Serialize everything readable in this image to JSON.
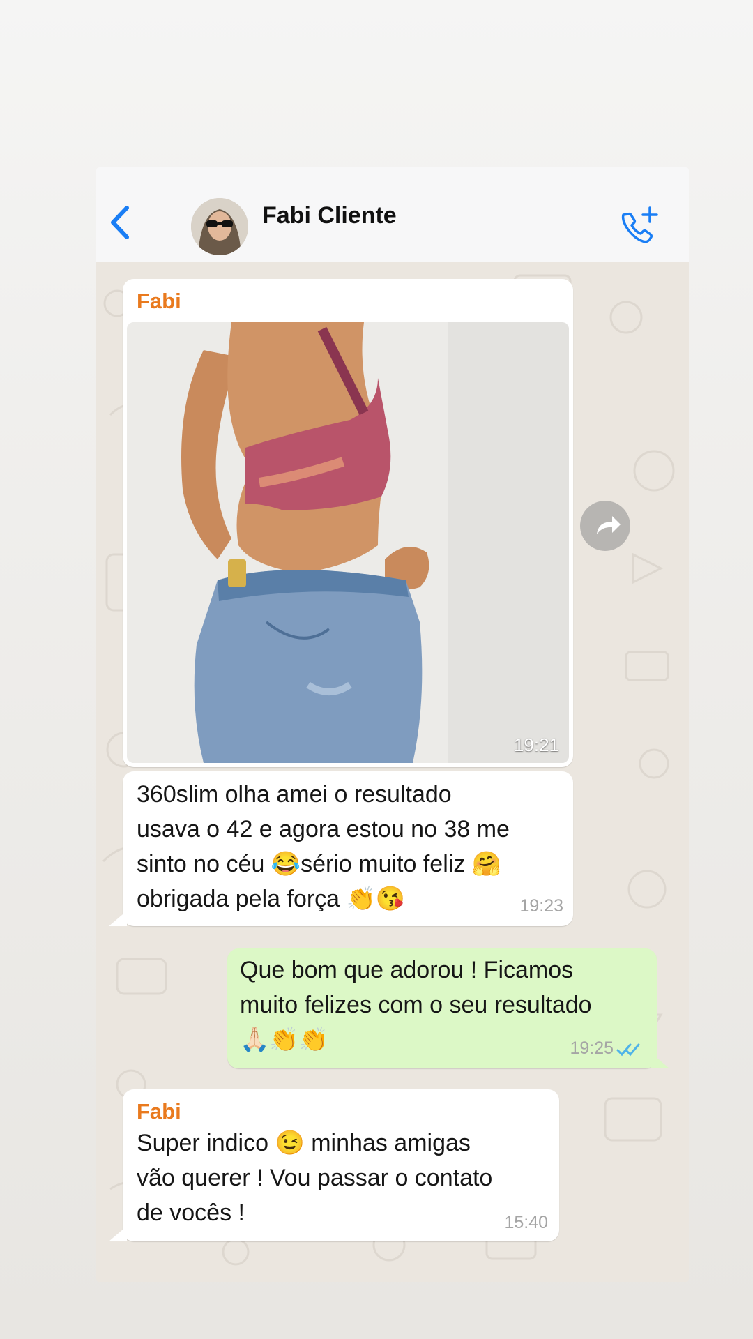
{
  "header": {
    "contact_name": "Fabi Cliente",
    "back_icon": "chevron-left-icon",
    "call_icon": "phone-add-icon",
    "accent_color": "#1a7ef5"
  },
  "messages": [
    {
      "direction": "incoming",
      "sender": "Fabi",
      "type": "image",
      "time": "19:21"
    },
    {
      "direction": "incoming",
      "text": "360slim olha amei o resultado\nusava o 42 e agora estou no 38 me\nsinto no céu 😂sério muito feliz 🤗\nobrigada pela força 👏😘",
      "time": "19:23"
    },
    {
      "direction": "outgoing",
      "text": "Que bom que adorou ! Ficamos\nmuito felizes com o seu resultado\n🙏🏻👏👏",
      "time": "19:25",
      "status": "read",
      "status_color": "#4fb3e8"
    },
    {
      "direction": "incoming",
      "sender": "Fabi",
      "text": "Super indico 😉 minhas amigas\nvão querer ! Vou passar o contato\nde vocês !",
      "time": "15:40"
    }
  ],
  "colors": {
    "sender_name": "#e97a1e",
    "incoming_bubble": "#ffffff",
    "outgoing_bubble": "#dcf8c6",
    "chat_background": "#ebe6df"
  }
}
